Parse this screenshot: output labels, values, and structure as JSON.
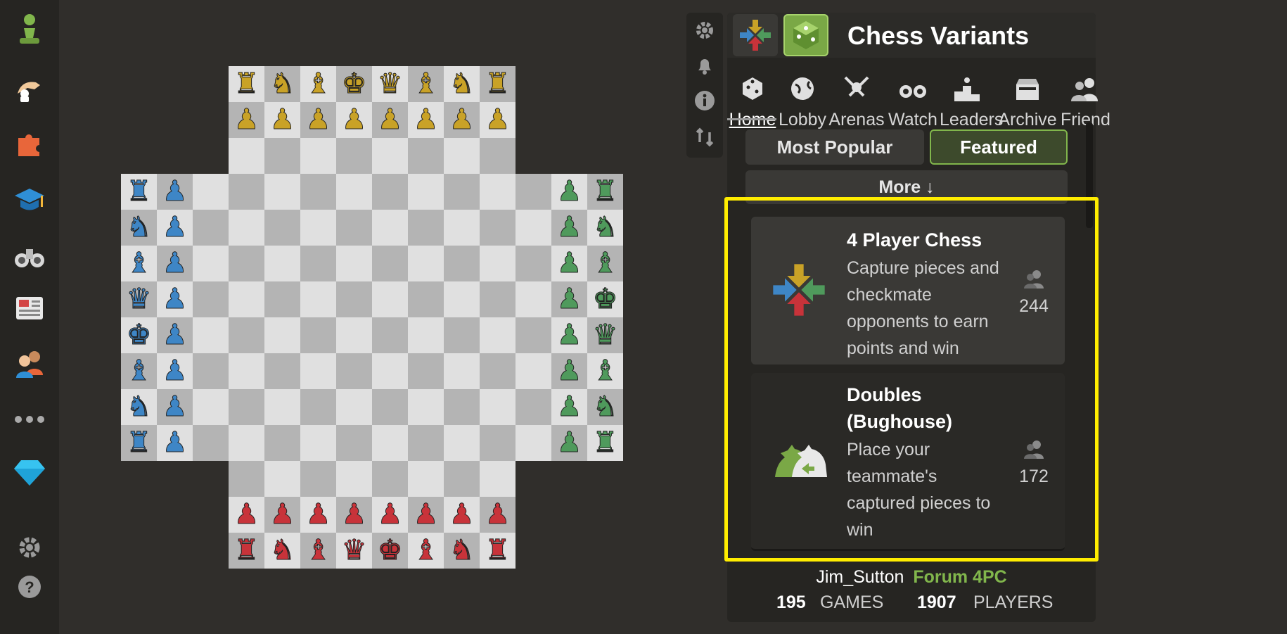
{
  "sidebar": {
    "items": [
      {
        "name": "logo-pawn-icon"
      },
      {
        "name": "play-icon"
      },
      {
        "name": "puzzles-icon"
      },
      {
        "name": "learn-icon"
      },
      {
        "name": "watch-icon"
      },
      {
        "name": "news-icon"
      },
      {
        "name": "social-icon"
      },
      {
        "name": "more-icon"
      },
      {
        "name": "premium-icon"
      },
      {
        "name": "settings-icon"
      },
      {
        "name": "help-icon"
      }
    ]
  },
  "board": {
    "colors": {
      "yellow": "#c9a227",
      "blue": "#3e86c6",
      "green": "#4f9a5c",
      "red": "#c8333a"
    },
    "yellow_back": [
      "♜",
      "♞",
      "♝",
      "♚",
      "♛",
      "♝",
      "♞",
      "♜"
    ],
    "red_back": [
      "♜",
      "♞",
      "♝",
      "♛",
      "♚",
      "♝",
      "♞",
      "♜"
    ],
    "blue_back": [
      "♜",
      "♞",
      "♝",
      "♛",
      "♚",
      "♝",
      "♞",
      "♜"
    ],
    "green_back": [
      "♜",
      "♞",
      "♝",
      "♚",
      "♛",
      "♝",
      "♞",
      "♜"
    ],
    "pawn": "♟"
  },
  "icon_column": [
    {
      "name": "settings-gear-icon"
    },
    {
      "name": "notifications-bell-icon"
    },
    {
      "name": "info-icon"
    },
    {
      "name": "flip-board-icon"
    }
  ],
  "panel": {
    "title": "Chess Variants",
    "tabs": [
      {
        "label": "Home",
        "icon": "home-icon",
        "active": true
      },
      {
        "label": "Lobby",
        "icon": "lobby-globe-icon"
      },
      {
        "label": "Arenas",
        "icon": "arenas-swords-icon"
      },
      {
        "label": "Watch",
        "icon": "watch-binoculars-icon"
      },
      {
        "label": "Leaders",
        "icon": "leaders-podium-icon"
      },
      {
        "label": "Archive",
        "icon": "archive-icon"
      },
      {
        "label": "Friends",
        "icon": "friends-icon"
      }
    ],
    "segments": {
      "popular": "Most Popular",
      "featured": "Featured"
    },
    "more_label": "More ↓",
    "cards": [
      {
        "title": "4 Player Chess",
        "desc": "Capture pieces and checkmate opponents to earn points and win",
        "players": "244"
      },
      {
        "title": "Doubles (Bughouse)",
        "desc": "Place your teammate's captured pieces to win",
        "players": "172"
      }
    ],
    "footer": {
      "user": "Jim_Sutton",
      "forum": "Forum 4PC",
      "games_count": "195",
      "games_label": "GAMES",
      "players_count": "1907",
      "players_label": "PLAYERS"
    }
  },
  "accent": "#81b64c",
  "highlight_color": "#ffed00"
}
